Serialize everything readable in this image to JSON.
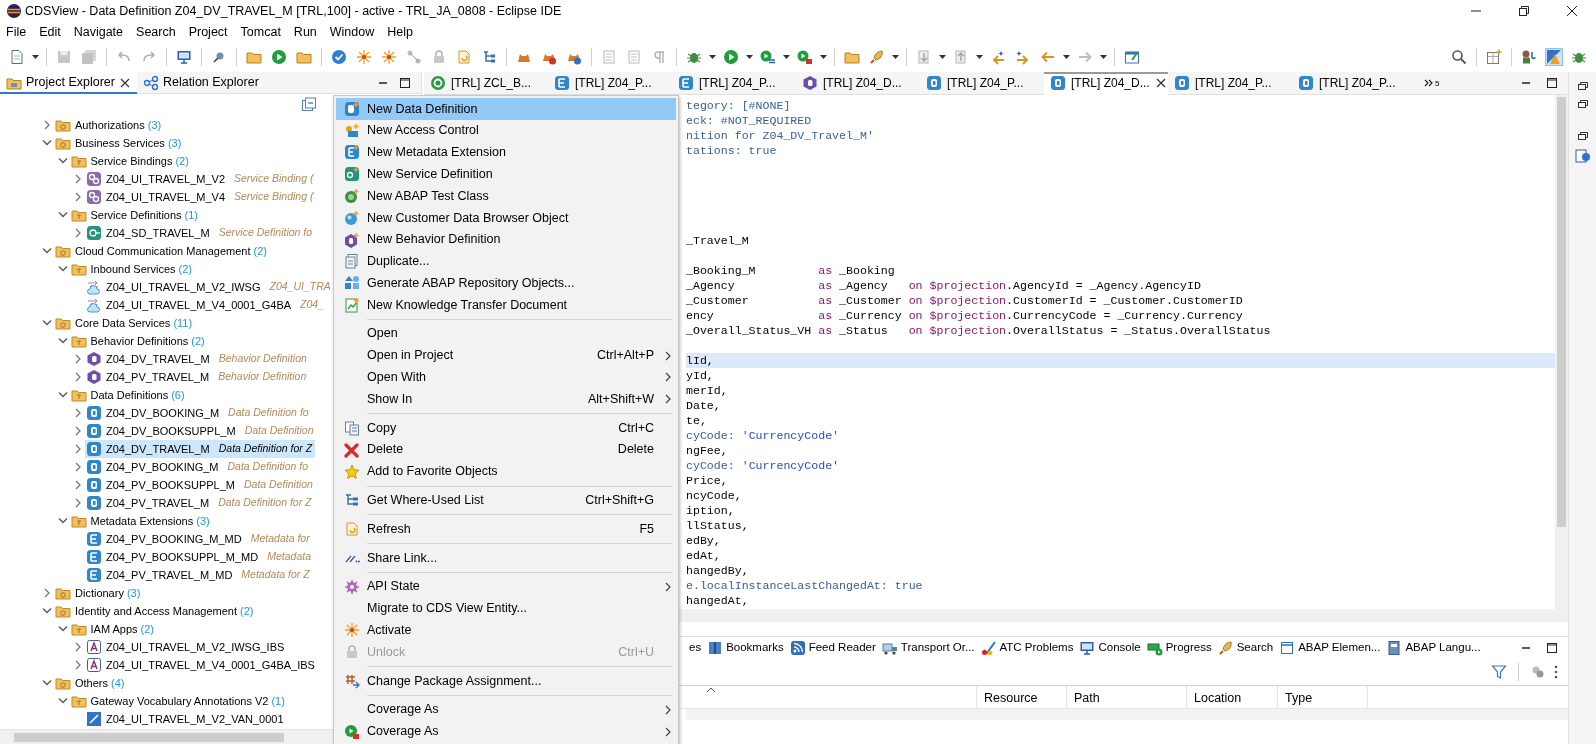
{
  "window": {
    "title": "CDSView - Data Definition Z04_DV_TRAVEL_M [TRL,100] - active - TRL_JA_0808 - Eclipse IDE"
  },
  "menu_bar": [
    "File",
    "Edit",
    "Navigate",
    "Search",
    "Project",
    "Tomcat",
    "Run",
    "Window",
    "Help"
  ],
  "explorer": {
    "tabs": [
      {
        "label": "Project Explorer",
        "selected": true
      },
      {
        "label": "Relation Explorer",
        "selected": false
      }
    ],
    "tree": [
      {
        "label": "Authorizations",
        "count": "(3)",
        "kind": "group",
        "expanded": false,
        "selected": false
      },
      {
        "label": "Business Services",
        "count": "(3)",
        "kind": "group",
        "expanded": true,
        "selected": false,
        "children": [
          {
            "label": "Service Bindings",
            "count": "(2)",
            "kind": "type",
            "expanded": true,
            "selected": false,
            "children": [
              {
                "label": "Z04_UI_TRAVEL_M_V2",
                "description": "Service Binding (",
                "kind": "service-binding",
                "expanded": false,
                "selected": false
              },
              {
                "label": "Z04_UI_TRAVEL_M_V4",
                "description": "Service Binding (",
                "kind": "service-binding",
                "expanded": false,
                "selected": false
              }
            ]
          },
          {
            "label": "Service Definitions",
            "count": "(1)",
            "kind": "type",
            "expanded": true,
            "selected": false,
            "children": [
              {
                "label": "Z04_SD_TRAVEL_M",
                "description": "Service Definition fo",
                "kind": "service-definition",
                "expanded": false,
                "selected": false
              }
            ]
          }
        ]
      },
      {
        "label": "Cloud Communication Management",
        "count": "(2)",
        "kind": "group",
        "expanded": true,
        "selected": false,
        "children": [
          {
            "label": "Inbound Services",
            "count": "(2)",
            "kind": "type",
            "expanded": true,
            "selected": false,
            "children": [
              {
                "label": "Z04_UI_TRAVEL_M_V2_IWSG",
                "description": "Z04_UI_TRA",
                "kind": "inbound-service",
                "selected": false
              },
              {
                "label": "Z04_UI_TRAVEL_M_V4_0001_G4BA",
                "description": "Z04_",
                "kind": "inbound-service",
                "selected": false
              }
            ]
          }
        ]
      },
      {
        "label": "Core Data Services",
        "count": "(11)",
        "kind": "group",
        "expanded": true,
        "selected": false,
        "children": [
          {
            "label": "Behavior Definitions",
            "count": "(2)",
            "kind": "type",
            "expanded": true,
            "selected": false,
            "children": [
              {
                "label": "Z04_DV_TRAVEL_M",
                "description": "Behavior Definition",
                "kind": "behavior",
                "expanded": false,
                "selected": false
              },
              {
                "label": "Z04_PV_TRAVEL_M",
                "description": "Behavior Definition",
                "kind": "behavior",
                "expanded": false,
                "selected": false
              }
            ]
          },
          {
            "label": "Data Definitions",
            "count": "(6)",
            "kind": "type",
            "expanded": true,
            "selected": false,
            "children": [
              {
                "label": "Z04_DV_BOOKING_M",
                "description": "Data Definition fo",
                "kind": "data-definition",
                "expanded": false,
                "selected": false
              },
              {
                "label": "Z04_DV_BOOKSUPPL_M",
                "description": "Data Definition",
                "kind": "data-definition",
                "expanded": false,
                "selected": false
              },
              {
                "label": "Z04_DV_TRAVEL_M",
                "description": "Data Definition for Z",
                "kind": "data-definition",
                "expanded": false,
                "selected": true
              },
              {
                "label": "Z04_PV_BOOKING_M",
                "description": "Data Definition fo",
                "kind": "data-definition",
                "expanded": false,
                "selected": false
              },
              {
                "label": "Z04_PV_BOOKSUPPL_M",
                "description": "Data Definition",
                "kind": "data-definition",
                "expanded": false,
                "selected": false
              },
              {
                "label": "Z04_PV_TRAVEL_M",
                "description": "Data Definition for Z",
                "kind": "data-definition",
                "expanded": false,
                "selected": false
              }
            ]
          },
          {
            "label": "Metadata Extensions",
            "count": "(3)",
            "kind": "type",
            "expanded": true,
            "selected": false,
            "children": [
              {
                "label": "Z04_PV_BOOKING_M_MD",
                "description": "Metadata for",
                "kind": "metadata-extension",
                "selected": false
              },
              {
                "label": "Z04_PV_BOOKSUPPL_M_MD",
                "description": "Metadata",
                "kind": "metadata-extension",
                "selected": false
              },
              {
                "label": "Z04_PV_TRAVEL_M_MD",
                "description": "Metadata for Z",
                "kind": "metadata-extension",
                "selected": false
              }
            ]
          }
        ]
      },
      {
        "label": "Dictionary",
        "count": "(3)",
        "kind": "group",
        "expanded": false,
        "selected": false
      },
      {
        "label": "Identity and Access Management",
        "count": "(2)",
        "kind": "group",
        "expanded": true,
        "selected": false,
        "children": [
          {
            "label": "IAM Apps",
            "count": "(2)",
            "kind": "type",
            "expanded": true,
            "selected": false,
            "children": [
              {
                "label": "Z04_UI_TRAVEL_M_V2_IWSG_IBS",
                "kind": "iam-app",
                "expanded": false,
                "selected": false
              },
              {
                "label": "Z04_UI_TRAVEL_M_V4_0001_G4BA_IBS",
                "kind": "iam-app",
                "expanded": false,
                "selected": false
              }
            ]
          }
        ]
      },
      {
        "label": "Others",
        "count": "(4)",
        "kind": "group",
        "expanded": true,
        "selected": false,
        "children": [
          {
            "label": "Gateway Vocabulary Annotations V2",
            "count": "(1)",
            "kind": "type",
            "expanded": true,
            "selected": false,
            "children": [
              {
                "label": "Z04_UI_TRAVEL_M_V2_VAN_0001",
                "kind": "vocabulary",
                "selected": false
              }
            ]
          }
        ]
      }
    ]
  },
  "editor": {
    "tabs": [
      {
        "label": "[TRL] ZCL_B...",
        "kind": "class",
        "selected": false
      },
      {
        "label": "[TRL] Z04_P...",
        "kind": "metadata-extension",
        "selected": false
      },
      {
        "label": "[TRL] Z04_P...",
        "kind": "metadata-extension",
        "selected": false
      },
      {
        "label": "[TRL] Z04_D...",
        "kind": "behavior",
        "selected": false
      },
      {
        "label": "[TRL] Z04_P...",
        "kind": "data-definition",
        "selected": false
      },
      {
        "label": "[TRL] Z04_D...",
        "kind": "data-definition",
        "selected": true
      },
      {
        "label": "[TRL] Z04_P...",
        "kind": "data-definition",
        "selected": false
      },
      {
        "label": "[TRL] Z04_P...",
        "kind": "data-definition",
        "selected": false
      }
    ],
    "hidden_tab_count": "5",
    "lines": [
      {
        "current": false,
        "tokens": [
          {
            "text": "tegory: [#NONE]",
            "kind": "annotation"
          }
        ]
      },
      {
        "current": false,
        "tokens": [
          {
            "text": "eck: #NOT_REQUIRED",
            "kind": "annotation"
          }
        ]
      },
      {
        "current": false,
        "tokens": [
          {
            "text": "nition for Z04_DV_Travel_M'",
            "kind": "annotation"
          }
        ]
      },
      {
        "current": false,
        "tokens": [
          {
            "text": "tations: true",
            "kind": "annotation"
          }
        ]
      },
      {
        "current": false
      },
      {
        "current": false
      },
      {
        "current": false
      },
      {
        "current": false
      },
      {
        "current": false
      },
      {
        "current": false,
        "tokens": [
          {
            "text": "_Travel_M",
            "kind": "plain"
          }
        ]
      },
      {
        "current": false
      },
      {
        "current": false,
        "tokens": [
          {
            "text": "_Booking_M         ",
            "kind": "plain"
          },
          {
            "text": "as",
            "kind": "keyword"
          },
          {
            "text": " _Booking",
            "kind": "plain"
          }
        ]
      },
      {
        "current": false,
        "tokens": [
          {
            "text": "_Agency            ",
            "kind": "plain"
          },
          {
            "text": "as",
            "kind": "keyword"
          },
          {
            "text": " _Agency   ",
            "kind": "plain"
          },
          {
            "text": "on $projection",
            "kind": "keyword"
          },
          {
            "text": ".AgencyId = _Agency.AgencyID",
            "kind": "plain"
          }
        ]
      },
      {
        "current": false,
        "tokens": [
          {
            "text": "_Customer          ",
            "kind": "plain"
          },
          {
            "text": "as",
            "kind": "keyword"
          },
          {
            "text": " _Customer ",
            "kind": "plain"
          },
          {
            "text": "on $projection",
            "kind": "keyword"
          },
          {
            "text": ".CustomerId = _Customer.CustomerID",
            "kind": "plain"
          }
        ]
      },
      {
        "current": false,
        "tokens": [
          {
            "text": "ency               ",
            "kind": "plain"
          },
          {
            "text": "as",
            "kind": "keyword"
          },
          {
            "text": " _Currency ",
            "kind": "plain"
          },
          {
            "text": "on $projection",
            "kind": "keyword"
          },
          {
            "text": ".CurrencyCode = _Currency.Currency",
            "kind": "plain"
          }
        ]
      },
      {
        "current": false,
        "tokens": [
          {
            "text": "_Overall_Status_VH ",
            "kind": "plain"
          },
          {
            "text": "as",
            "kind": "keyword"
          },
          {
            "text": " _Status   ",
            "kind": "plain"
          },
          {
            "text": "on $projection",
            "kind": "keyword"
          },
          {
            "text": ".OverallStatus = _Status.OverallStatus",
            "kind": "plain"
          }
        ]
      },
      {
        "current": false
      },
      {
        "current": true,
        "tokens": [
          {
            "text": "lId,",
            "kind": "plain"
          }
        ]
      },
      {
        "current": false,
        "tokens": [
          {
            "text": "yId,",
            "kind": "plain"
          }
        ]
      },
      {
        "current": false,
        "tokens": [
          {
            "text": "merId,",
            "kind": "plain"
          }
        ]
      },
      {
        "current": false,
        "tokens": [
          {
            "text": "Date,",
            "kind": "plain"
          }
        ]
      },
      {
        "current": false,
        "tokens": [
          {
            "text": "te,",
            "kind": "plain"
          }
        ]
      },
      {
        "current": false,
        "tokens": [
          {
            "text": "cyCode: ",
            "kind": "annotation"
          },
          {
            "text": "'CurrencyCode'",
            "kind": "string"
          }
        ]
      },
      {
        "current": false,
        "tokens": [
          {
            "text": "ngFee,",
            "kind": "plain"
          }
        ]
      },
      {
        "current": false,
        "tokens": [
          {
            "text": "cyCode: ",
            "kind": "annotation"
          },
          {
            "text": "'CurrencyCode'",
            "kind": "string"
          }
        ]
      },
      {
        "current": false,
        "tokens": [
          {
            "text": "Price,",
            "kind": "plain"
          }
        ]
      },
      {
        "current": false,
        "tokens": [
          {
            "text": "ncyCode,",
            "kind": "plain"
          }
        ]
      },
      {
        "current": false,
        "tokens": [
          {
            "text": "iption,",
            "kind": "plain"
          }
        ]
      },
      {
        "current": false,
        "tokens": [
          {
            "text": "llStatus,",
            "kind": "plain"
          }
        ]
      },
      {
        "current": false,
        "tokens": [
          {
            "text": "edBy,",
            "kind": "plain"
          }
        ]
      },
      {
        "current": false,
        "tokens": [
          {
            "text": "edAt,",
            "kind": "plain"
          }
        ]
      },
      {
        "current": false,
        "tokens": [
          {
            "text": "hangedBy,",
            "kind": "plain"
          }
        ]
      },
      {
        "current": false,
        "tokens": [
          {
            "text": "e.localInstanceLastChangedAt: true",
            "kind": "annotation"
          }
        ]
      },
      {
        "current": false,
        "tokens": [
          {
            "text": "hangedAt,",
            "kind": "plain"
          }
        ]
      }
    ]
  },
  "context_menu": {
    "groups": [
      [
        {
          "label": "New Data Definition",
          "selected": true,
          "disabled": false,
          "submenu": false
        },
        {
          "label": "New Access Control",
          "selected": false,
          "disabled": false,
          "submenu": false
        },
        {
          "label": "New Metadata Extension",
          "selected": false,
          "disabled": false,
          "submenu": false
        },
        {
          "label": "New Service Definition",
          "selected": false,
          "disabled": false,
          "submenu": false
        },
        {
          "label": "New ABAP Test Class",
          "selected": false,
          "disabled": false,
          "submenu": false
        },
        {
          "label": "New Customer Data Browser Object",
          "selected": false,
          "disabled": false,
          "submenu": false
        },
        {
          "label": "New Behavior Definition",
          "selected": false,
          "disabled": false,
          "submenu": false
        },
        {
          "label": "Duplicate...",
          "selected": false,
          "disabled": false,
          "submenu": false
        },
        {
          "label": "Generate ABAP Repository Objects...",
          "selected": false,
          "disabled": false,
          "submenu": false
        },
        {
          "label": "New Knowledge Transfer Document",
          "selected": false,
          "disabled": false,
          "submenu": false
        }
      ],
      [
        {
          "label": "Open",
          "selected": false,
          "disabled": false,
          "submenu": false
        },
        {
          "label": "Open in Project",
          "shortcut": "Ctrl+Alt+P",
          "selected": false,
          "disabled": false,
          "submenu": true
        },
        {
          "label": "Open With",
          "selected": false,
          "disabled": false,
          "submenu": true
        },
        {
          "label": "Show In",
          "shortcut": "Alt+Shift+W",
          "selected": false,
          "disabled": false,
          "submenu": true
        }
      ],
      [
        {
          "label": "Copy",
          "shortcut": "Ctrl+C",
          "selected": false,
          "disabled": false,
          "submenu": false
        },
        {
          "label": "Delete",
          "shortcut": "Delete",
          "selected": false,
          "disabled": false,
          "submenu": false
        },
        {
          "label": "Add to Favorite Objects",
          "selected": false,
          "disabled": false,
          "submenu": false
        }
      ],
      [
        {
          "label": "Get Where-Used List",
          "shortcut": "Ctrl+Shift+G",
          "selected": false,
          "disabled": false,
          "submenu": false
        }
      ],
      [
        {
          "label": "Refresh",
          "shortcut": "F5",
          "selected": false,
          "disabled": false,
          "submenu": false
        }
      ],
      [
        {
          "label": "Share Link...",
          "selected": false,
          "disabled": false,
          "submenu": false
        }
      ],
      [
        {
          "label": "API State",
          "selected": false,
          "disabled": false,
          "submenu": true
        },
        {
          "label": "Migrate to CDS View Entity...",
          "selected": false,
          "disabled": false,
          "submenu": false
        },
        {
          "label": "Activate",
          "selected": false,
          "disabled": false,
          "submenu": false
        },
        {
          "label": "Unlock",
          "shortcut": "Ctrl+U",
          "selected": false,
          "disabled": true,
          "submenu": false
        }
      ],
      [
        {
          "label": "Change Package Assignment...",
          "selected": false,
          "disabled": false,
          "submenu": false
        }
      ],
      [
        {
          "label": "Coverage As",
          "selected": false,
          "disabled": false,
          "submenu": true
        },
        {
          "label": "Coverage As",
          "selected": false,
          "disabled": false,
          "submenu": true
        }
      ]
    ]
  },
  "bottom_panel": {
    "tabs": [
      {
        "label": "es",
        "kind": "properties",
        "selected": false
      },
      {
        "label": "Bookmarks",
        "kind": "bookmarks",
        "selected": false
      },
      {
        "label": "Feed Reader",
        "kind": "feed",
        "selected": false
      },
      {
        "label": "Transport Or...",
        "kind": "transport",
        "selected": false
      },
      {
        "label": "ATC Problems",
        "kind": "atc",
        "selected": false
      },
      {
        "label": "Console",
        "kind": "console",
        "selected": false
      },
      {
        "label": "Progress",
        "kind": "progress",
        "selected": false
      },
      {
        "label": "Search",
        "kind": "search",
        "selected": false
      },
      {
        "label": "ABAP Elemen...",
        "kind": "element",
        "selected": false
      },
      {
        "label": "ABAP Langu...",
        "kind": "language",
        "selected": false
      }
    ],
    "columns": [
      "Resource",
      "Path",
      "Location",
      "Type"
    ]
  }
}
